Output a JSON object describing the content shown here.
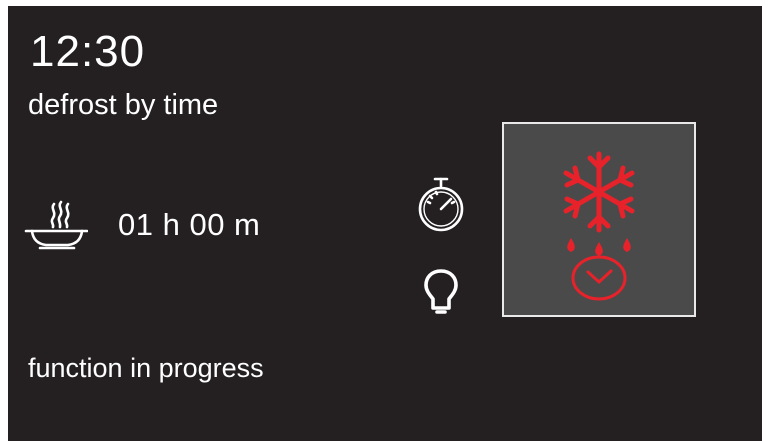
{
  "display": {
    "time": "12:30",
    "mode": "defrost by time",
    "duration": "01 h 00 m",
    "status": "function in progress"
  },
  "icons": {
    "dish": "steaming-dish-icon",
    "timer": "stopwatch-icon",
    "light": "light-bulb-icon",
    "defrost": "snowflake-drops-icon",
    "clock": "clock-icon"
  },
  "colors": {
    "background": "#242021",
    "text": "#ffffff",
    "accent": "#e8222a",
    "panel": "#4a4a4a"
  }
}
